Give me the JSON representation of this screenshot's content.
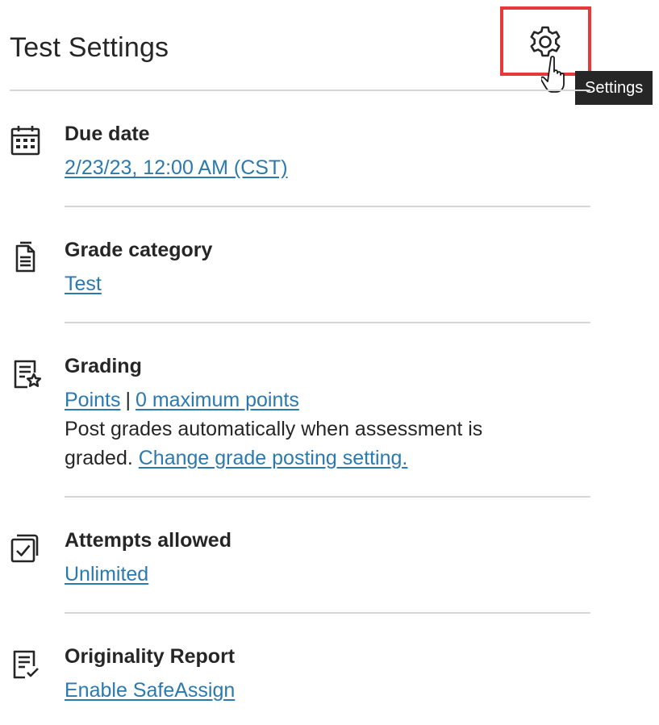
{
  "header": {
    "title": "Test Settings",
    "settings_icon": "gear-icon",
    "tooltip": "Settings"
  },
  "items": [
    {
      "label": "Due date",
      "icon": "calendar-icon",
      "value_link": "2/23/23, 12:00 AM (CST)"
    },
    {
      "label": "Grade category",
      "icon": "document-icon",
      "value_link": "Test"
    },
    {
      "label": "Grading",
      "icon": "grading-star-icon",
      "link_1": "Points",
      "separator": "|",
      "link_2": "0 maximum points",
      "desc_line_1": "Post grades automatically when assessment is",
      "desc_line_2_prefix": "graded.",
      "desc_link": "Change grade posting setting."
    },
    {
      "label": "Attempts allowed",
      "icon": "attempts-check-icon",
      "value_link": "Unlimited"
    },
    {
      "label": "Originality Report",
      "icon": "originality-check-icon",
      "value_link": "Enable SafeAssign"
    }
  ],
  "colors": {
    "link": "#2a7ab0",
    "highlight": "#e8393a",
    "tooltip_bg": "#262626",
    "divider": "#d6d6d6"
  }
}
